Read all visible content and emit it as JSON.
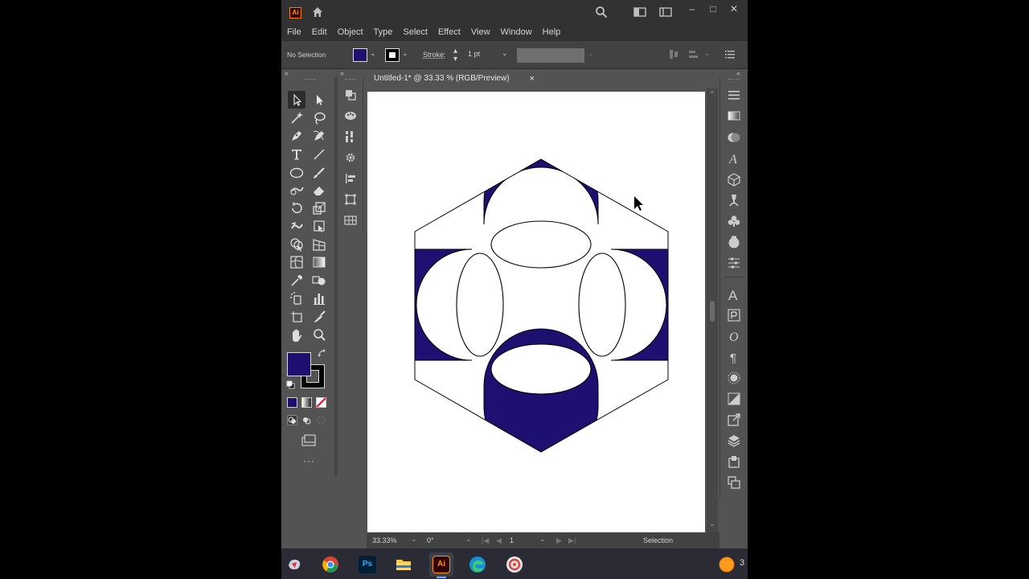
{
  "app": {
    "logo_text": "Ai",
    "menu": [
      "File",
      "Edit",
      "Object",
      "Type",
      "Select",
      "Effect",
      "View",
      "Window",
      "Help"
    ]
  },
  "control_bar": {
    "selection_label": "No Selection",
    "stroke_label": "Stroke:",
    "stroke_weight": "1 pt",
    "fill_color": "#1e1070"
  },
  "document": {
    "tab_title": "Untitled-1* @ 33.33 % (RGB/Preview)",
    "close_glyph": "×"
  },
  "status": {
    "zoom": "33.33%",
    "rotation": "0°",
    "artboard_number": "1",
    "tool_name": "Selection"
  },
  "colors": {
    "accent_fill": "#1e1070",
    "stroke": "#000000",
    "panel_bg": "#535353",
    "titlebar_bg": "#323232"
  },
  "taskbar": {
    "ps_label": "Ps",
    "ai_label": "Ai",
    "tray_text": "3"
  }
}
